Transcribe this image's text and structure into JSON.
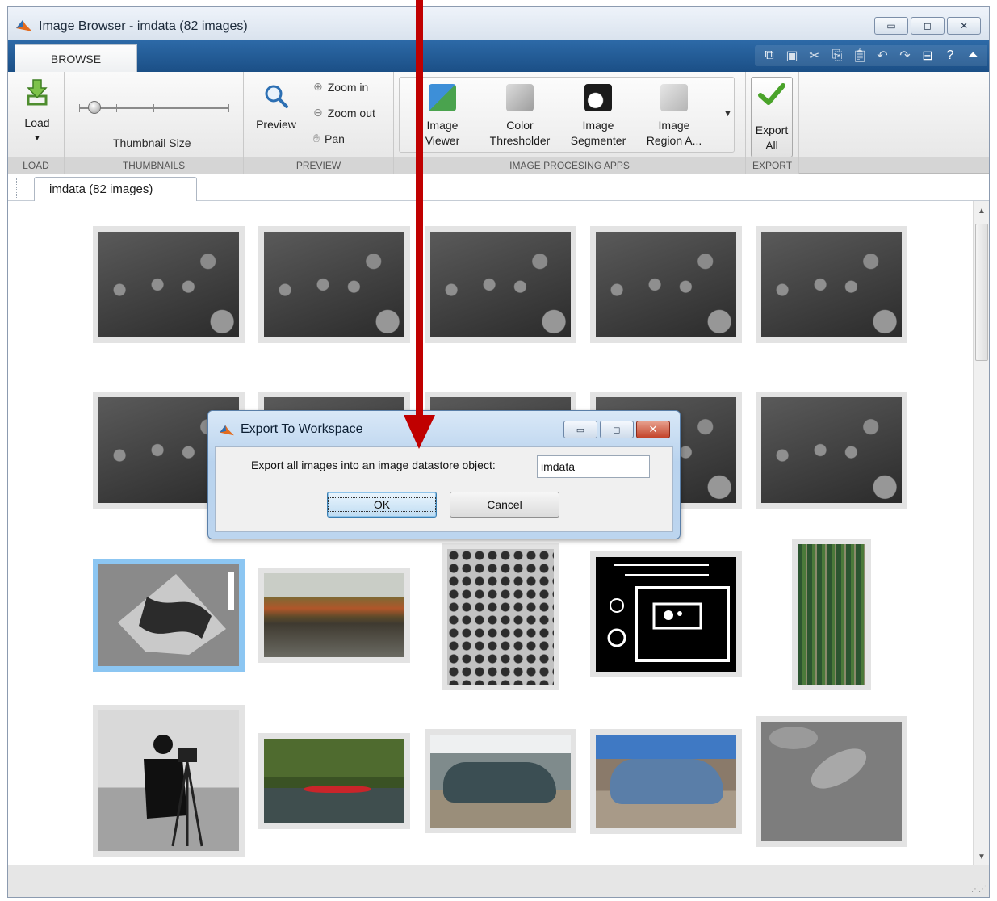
{
  "window": {
    "title": "Image Browser - imdata (82 images)",
    "controls": [
      "minimize",
      "maximize",
      "close"
    ]
  },
  "tabbar": {
    "active_tab": "BROWSE",
    "quick_access_icons": [
      "dock-icon",
      "save-icon",
      "cut-icon",
      "copy-icon",
      "paste-icon",
      "undo-icon",
      "redo-icon",
      "switch-windows-icon",
      "help-icon",
      "collapse-icon"
    ]
  },
  "ribbon": {
    "load": {
      "label": "Load",
      "section": "LOAD"
    },
    "thumbnails": {
      "label": "Thumbnail Size",
      "section": "THUMBNAILS",
      "slider_fraction": 0.1
    },
    "preview": {
      "label": "Preview",
      "zoom_in": "Zoom in",
      "zoom_out": "Zoom out",
      "pan": "Pan",
      "section": "PREVIEW"
    },
    "apps": {
      "section": "IMAGE PROCESING APPS",
      "items": [
        {
          "line1": "Image",
          "line2": "Viewer"
        },
        {
          "line1": "Color",
          "line2": "Thresholder"
        },
        {
          "line1": "Image",
          "line2": "Segmenter"
        },
        {
          "line1": "Image",
          "line2": "Region A..."
        }
      ]
    },
    "export": {
      "line1": "Export",
      "line2": "All",
      "section": "EXPORT"
    }
  },
  "document_tab": {
    "label": "imdata (82 images)"
  },
  "thumbnails": [
    "cell-microscopy",
    "cell-microscopy",
    "cell-microscopy",
    "cell-microscopy",
    "cell-microscopy",
    "cell-microscopy",
    "cell-microscopy",
    "cell-microscopy",
    "cell-microscopy",
    "cell-microscopy",
    "ultrasound-sector",
    "autumn-lake",
    "textured-surface",
    "binary-circuit-shapes",
    "circuit-board",
    "cameraman",
    "canoe",
    "vintage-car-green",
    "vintage-car-blue",
    "cell-closeup"
  ],
  "dialog": {
    "title": "Export To Workspace",
    "label": "Export all images into an image datastore object:",
    "input_value": "imdata",
    "ok": "OK",
    "cancel": "Cancel"
  },
  "colors": {
    "tabbar_blue": "#1f5a93",
    "selection": "#8cc6f2",
    "arrow_red": "#c00000"
  }
}
